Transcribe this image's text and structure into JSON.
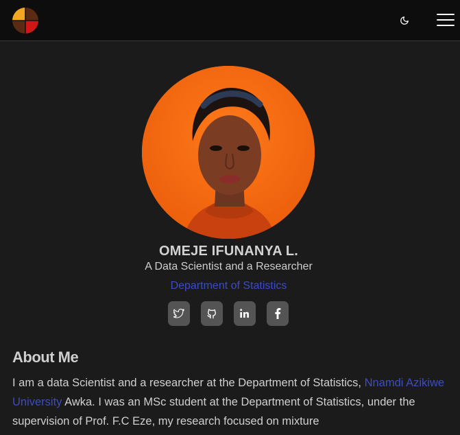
{
  "navbar": {
    "logo_icon": "quartered-circle-logo",
    "theme_toggle_icon": "moon-icon",
    "menu_icon": "hamburger-menu-icon"
  },
  "profile": {
    "name": "OMEJE IFUNANYA L.",
    "role": "A Data Scientist and a Researcher",
    "department_link": "Department of Statistics",
    "avatar_background_color": "#f26a12"
  },
  "socials": [
    {
      "icon": "twitter-icon"
    },
    {
      "icon": "github-icon"
    },
    {
      "icon": "linkedin-icon"
    },
    {
      "icon": "facebook-icon"
    }
  ],
  "about": {
    "title": "About Me",
    "text_before_link": "I am a data Scientist and a researcher at the Department of Statistics, ",
    "link_text": "Nnamdi Azikiwe University",
    "text_after_link": " Awka. I was an MSc student at the Department of Statistics, under the supervision of Prof. F.C Eze, my research focused on mixture"
  },
  "colors": {
    "background": "#1b1b1b",
    "navbar": "#0d0d0d",
    "link": "#3c4cc4",
    "social_button": "#545454"
  }
}
